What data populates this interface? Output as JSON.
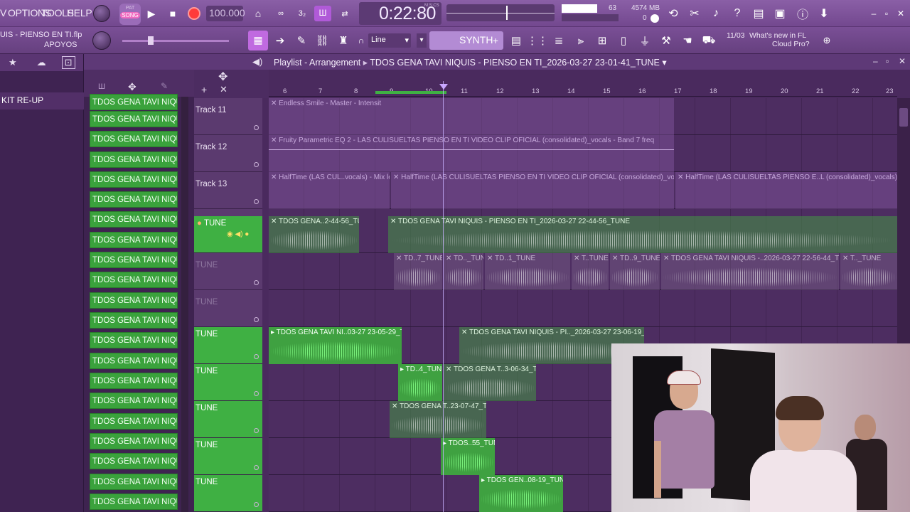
{
  "menu": {
    "items": [
      "V",
      "OPTIONS",
      "TOOLS",
      "HELP"
    ]
  },
  "transport": {
    "mode_top": "PAT",
    "mode_bottom": "SONG",
    "tempo": "100.000",
    "time": "0:22:80",
    "time_unit": "M:S:CS",
    "cpu_value": "63",
    "memory": "4574 MB",
    "voices": "0"
  },
  "project": {
    "file": "UIS - PIENSO EN TI.flp",
    "folder": "APOYOS"
  },
  "toolbar2": {
    "snap": "Line",
    "synth": "SYNTH"
  },
  "news": {
    "date": "11/03",
    "text": "What's new in FL Cloud Pro?"
  },
  "browser": {
    "selected": "KIT RE-UP"
  },
  "playlist": {
    "title": "Playlist - Arrangement",
    "pattern": "TDOS GENA TAVI NIQUIS - PIENSO EN TI_2026-03-27 23-01-41_TUNE",
    "bars": [
      "6",
      "7",
      "8",
      "9",
      "10",
      "11",
      "12",
      "13",
      "14",
      "15",
      "16",
      "17",
      "18",
      "19",
      "20",
      "21",
      "22",
      "23"
    ]
  },
  "channels": {
    "label": "TDOS GENA TAVI NIQUIS - ..."
  },
  "tracks": [
    {
      "name": "Track 11"
    },
    {
      "name": "Track 12"
    },
    {
      "name": "Track 13"
    },
    {
      "name": "TUNE"
    },
    {
      "name": "TUNE"
    },
    {
      "name": "TUNE"
    },
    {
      "name": "TUNE"
    },
    {
      "name": "TUNE"
    },
    {
      "name": "TUNE"
    },
    {
      "name": "TUNE"
    },
    {
      "name": "TUNE"
    }
  ],
  "clips": {
    "c11": "Endless Smile - Master - Intensit",
    "c12": "Fruity Parametric EQ 2 - LAS CULISUELTAS PIENSO EN TI VIDEO CLIP OFICIAL (consolidated)_vocals - Band 7 freq",
    "c13a": "HalfTime (LAS CUL..vocals) - Mix level",
    "c13b": "HalfTime (LAS CULISUELTAS PIENSO EN TI VIDEO CLIP OFICIAL (consolidated)_vocals) - Mix level",
    "c13c": "HalfTime (LAS CULISUELTAS PIENSO E..L (consolidated)_vocals) - Mix level",
    "t1a": "TDOS GENA..2-44-56_TUNE",
    "t1b": "TDOS GENA TAVI NIQUIS - PIENSO EN TI_2026-03-27 22-44-56_TUNE",
    "t2a": "TD..7_TUNE",
    "t2b": "TD.._TUNE",
    "t2c": "TD..1_TUNE",
    "t2d": "T..TUNE",
    "t2e": "TD..9_TUNE",
    "t2f": "TDOS GENA TAVI NIQUIS -..2026-03-27 22-56-44_TUNE",
    "t2g": "T.._TUNE",
    "t4a": "TDOS GENA TAVI NI..03-27 23-05-29_TUNE",
    "t4b": "TDOS GENA TAVI NIQUIS - PI.._2026-03-27 23-06-19_TUNE",
    "t5a": "TD..4_TUNE",
    "t5b": "TDOS GENA T..3-06-34_TUNE",
    "t6": "TDOS GENA T..23-07-47_TUNE",
    "t7": "TDOS..55_TUNE",
    "t8": "TDOS GEN..08-19_TUNE"
  },
  "colors": {
    "accent": "#8a5fa6",
    "green": "#3fb043"
  }
}
